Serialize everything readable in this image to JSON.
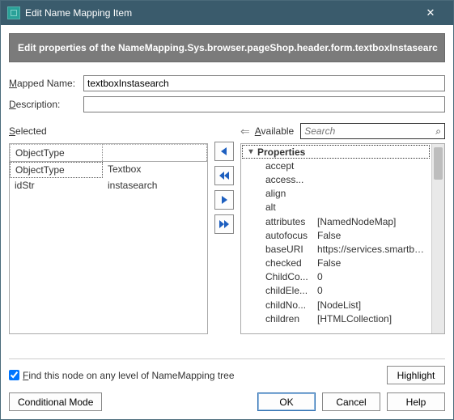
{
  "window": {
    "title": "Edit Name Mapping Item",
    "close_glyph": "✕"
  },
  "banner": "Edit properties of the NameMapping.Sys.browser.pageShop.header.form.textboxInstasearc",
  "form": {
    "mapped_name_label_pre": "M",
    "mapped_name_label_post": "apped Name:",
    "mapped_name_value": "textboxInstasearch",
    "description_label_pre": "D",
    "description_label_post": "escription:",
    "description_value": ""
  },
  "left": {
    "header_pre": "S",
    "header_post": "elected",
    "columns": {
      "c1": "ObjectType",
      "c2": ""
    },
    "rows": [
      {
        "k": "ObjectType",
        "v": "Textbox"
      },
      {
        "k": "idStr",
        "v": "instasearch"
      }
    ]
  },
  "right": {
    "back_glyph": "⇐",
    "header_pre": "A",
    "header_post": "vailable",
    "search_placeholder": "Search",
    "search_icon": "⌕",
    "root_label": "Properties",
    "items": [
      {
        "k": "accept",
        "v": ""
      },
      {
        "k": "access...",
        "v": ""
      },
      {
        "k": "align",
        "v": ""
      },
      {
        "k": "alt",
        "v": ""
      },
      {
        "k": "attributes",
        "v": "[NamedNodeMap]"
      },
      {
        "k": "autofocus",
        "v": "False"
      },
      {
        "k": "baseURI",
        "v": "https://services.smartbear..."
      },
      {
        "k": "checked",
        "v": "False"
      },
      {
        "k": "ChildCo...",
        "v": "0"
      },
      {
        "k": "childEle...",
        "v": "0"
      },
      {
        "k": "childNo...",
        "v": "[NodeList]"
      },
      {
        "k": "children",
        "v": "[HTMLCollection]"
      }
    ]
  },
  "checkbox": {
    "pre": "F",
    "post": "ind this node on any level of NameMapping tree",
    "checked": true
  },
  "buttons": {
    "highlight": "Highlight",
    "conditional": "Conditional Mode",
    "ok": "OK",
    "cancel": "Cancel",
    "help": "Help"
  },
  "arrows": {
    "color": "#1d5fbf"
  }
}
